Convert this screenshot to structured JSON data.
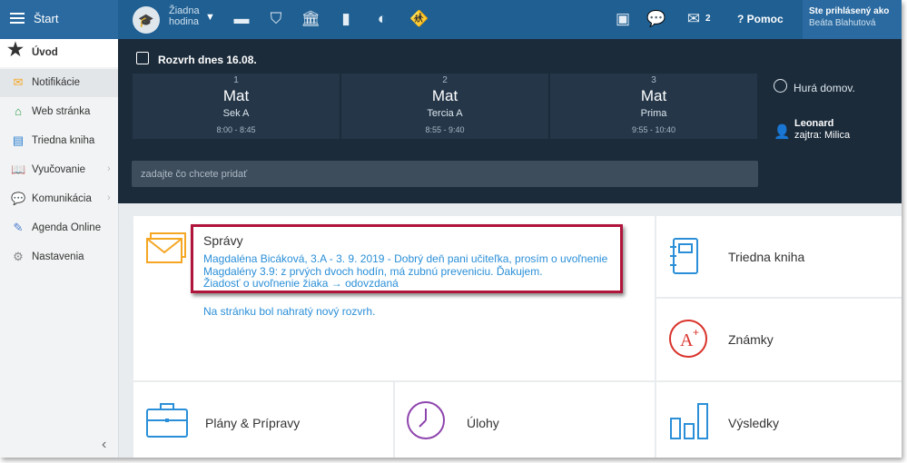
{
  "topbar": {
    "start_label": "Štart",
    "period_line1": "Žiadna",
    "period_line2": "hodina",
    "messages_count": "2",
    "help_label": "Pomoc",
    "user_line1": "Ste prihlásený ako",
    "user_line2": "Beáta Blahutová"
  },
  "sidebar": {
    "items": [
      {
        "label": "Úvod",
        "icon": "star-icon"
      },
      {
        "label": "Notifikácie",
        "icon": "envelope-icon"
      },
      {
        "label": "Web stránka",
        "icon": "home-icon"
      },
      {
        "label": "Triedna kniha",
        "icon": "book-icon"
      },
      {
        "label": "Vyučovanie",
        "icon": "open-book-icon"
      },
      {
        "label": "Komunikácia",
        "icon": "chat-icon"
      },
      {
        "label": "Agenda Online",
        "icon": "pen-icon"
      },
      {
        "label": "Nastavenia",
        "icon": "gear-icon"
      }
    ]
  },
  "schedule": {
    "title": "Rozvrh dnes 16.08.",
    "lessons": [
      {
        "number": "1",
        "subject": "Mat",
        "class": "Sek A",
        "time": "8:00 - 8:45"
      },
      {
        "number": "2",
        "subject": "Mat",
        "class": "Tercia A",
        "time": "8:55 - 9:40"
      },
      {
        "number": "3",
        "subject": "Mat",
        "class": "Prima",
        "time": "9:55 - 10:40"
      }
    ],
    "home_text": "Hurá domov.",
    "duty_name": "Leonard",
    "duty_tomorrow": "zajtra: Milica",
    "add_placeholder": "zadajte čo chcete pridať"
  },
  "tiles": {
    "messages": {
      "title": "Správy",
      "lines": [
        "Magdaléna Bicáková, 3.A - 3. 9. 2019 - Dobrý deň pani učiteľka, prosím o uvoľnenie",
        "Magdalény 3.9: z prvých dvoch hodín, má zubnú preveniciu. Ďakujem.",
        "Žiadosť o uvoľnenie žiaka → odovzdaná",
        "Na stránku bol nahratý nový rozvrh."
      ]
    },
    "class_book": "Triedna kniha",
    "grades": "Známky",
    "plans": "Plány & Prípravy",
    "tasks": "Úlohy",
    "results": "Výsledky"
  },
  "colors": {
    "topbar": "#1f5f92",
    "dark_panel": "#1b2b3a",
    "link": "#2a8fd8",
    "orange": "#f5a623",
    "highlight_red": "#b0143a"
  }
}
